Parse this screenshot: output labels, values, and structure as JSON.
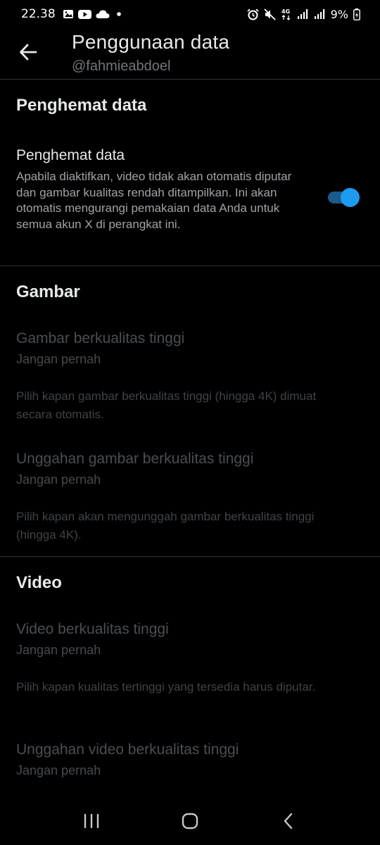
{
  "status_bar": {
    "time": "22.38",
    "battery": "9%",
    "network": "4G",
    "icons": [
      "gallery-icon",
      "youtube-icon",
      "cloud-icon",
      "dot-icon",
      "alarm-icon",
      "mute-icon",
      "signal-icon",
      "battery-icon"
    ]
  },
  "header": {
    "title": "Penggunaan data",
    "username": "@fahmieabdoel",
    "back_icon": "arrow-left-icon"
  },
  "sections": {
    "data_saver": {
      "title": "Penghemat data",
      "setting": {
        "title": "Penghemat data",
        "description": "Apabila diaktifkan, video tidak akan otomatis diputar dan gambar kualitas rendah ditampilkan. Ini akan otomatis mengurangi pemakaian data Anda untuk semua akun X di perangkat ini.",
        "enabled": true
      }
    },
    "images": {
      "title": "Gambar",
      "hq_images": {
        "title": "Gambar berkualitas tinggi",
        "value": "Jangan pernah",
        "description": "Pilih kapan gambar berkualitas tinggi (hingga 4K) dimuat secara otomatis."
      },
      "hq_image_uploads": {
        "title": "Unggahan gambar berkualitas tinggi",
        "value": "Jangan pernah",
        "description": "Pilih kapan akan mengunggah gambar berkualitas tinggi (hingga 4K)."
      }
    },
    "video": {
      "title": "Video",
      "hq_video": {
        "title": "Video berkualitas tinggi",
        "value": "Jangan pernah",
        "description": "Pilih kapan kualitas tertinggi yang tersedia harus diputar."
      },
      "hq_video_uploads": {
        "title": "Unggahan video berkualitas tinggi",
        "value": "Jangan pernah"
      }
    }
  },
  "colors": {
    "background": "#000000",
    "accent": "#1d9bf0",
    "divider": "#2f3336"
  },
  "nav_bar": {
    "icons": [
      "recents-icon",
      "home-icon",
      "back-icon"
    ]
  }
}
